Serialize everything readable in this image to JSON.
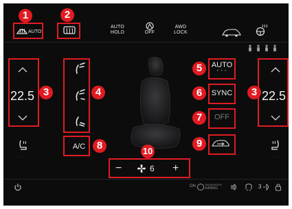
{
  "top_bar": {
    "rear_defrost_label": "AUTO",
    "auto_hold": [
      "AUTO",
      "HOLD"
    ],
    "esc_off_label": "OFF",
    "awd_lock": [
      "AWD",
      "LOCK"
    ]
  },
  "left_zone": {
    "temperature": "22.5",
    "up_glyph": "⌃",
    "down_glyph": "⌄"
  },
  "right_zone": {
    "temperature": "22.5",
    "up_glyph": "⌃",
    "down_glyph": "⌄"
  },
  "mode_buttons": {
    "auto_label": "AUTO",
    "auto_dots": "• • •",
    "sync_label": "SYNC",
    "off_label": "OFF",
    "ac_label": "A/C"
  },
  "fan": {
    "minus": "−",
    "plus": "+",
    "speed": "6"
  },
  "heated_seat_dots": "· · ·",
  "bottom_bar": {
    "airbag_line1": "PASSENGER",
    "airbag_line2": "AIRBAG",
    "airbag_prefix": "ON",
    "count_label": "3"
  },
  "callouts": [
    "1",
    "2",
    "3",
    "4",
    "5",
    "6",
    "7",
    "8",
    "9",
    "10"
  ],
  "colors": {
    "callout_red": "#e11b22",
    "background": "#0c0c0d",
    "text": "#e8e8e8"
  }
}
